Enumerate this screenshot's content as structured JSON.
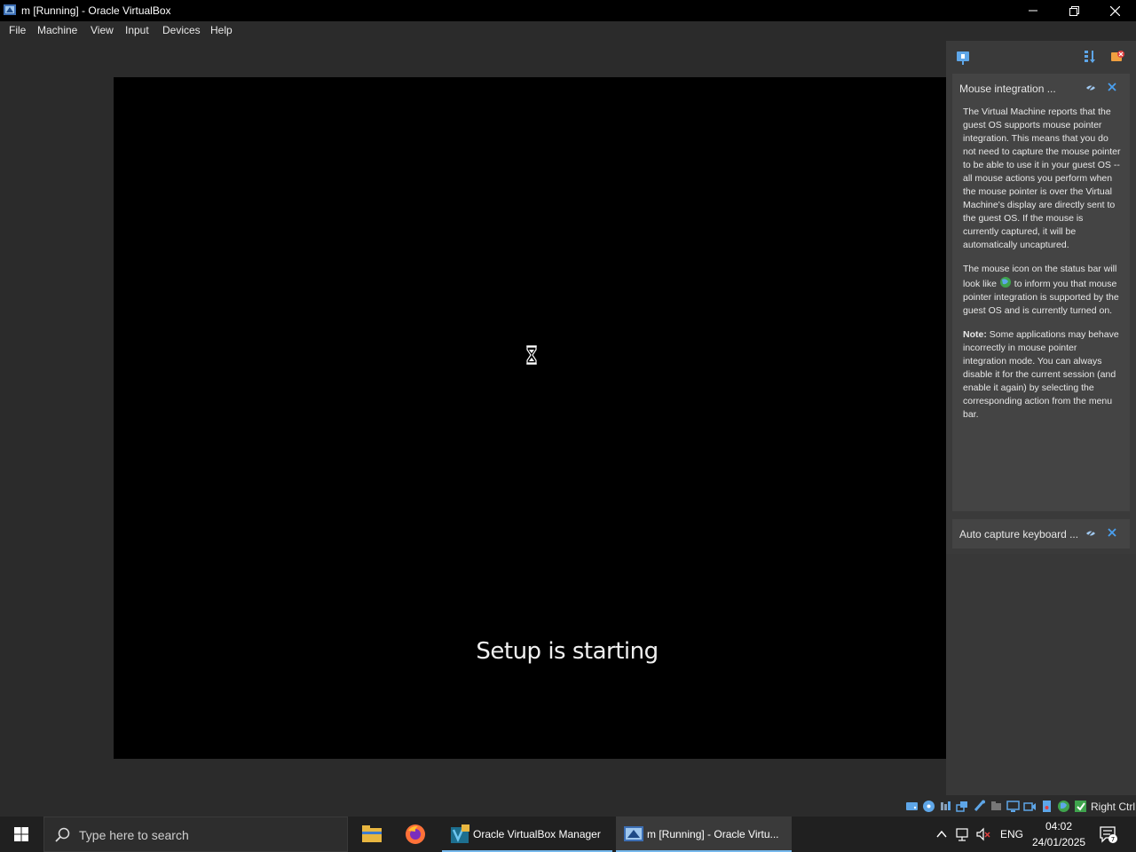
{
  "window": {
    "title": "m [Running] - Oracle VirtualBox",
    "minimize_icon": "minimize-icon",
    "maximize_icon": "restore-icon",
    "close_icon": "close-icon"
  },
  "menu": {
    "items": [
      {
        "label": "File"
      },
      {
        "label": "Machine"
      },
      {
        "label": "View"
      },
      {
        "label": "Input"
      },
      {
        "label": "Devices"
      },
      {
        "label": "Help"
      }
    ]
  },
  "vm_screen": {
    "status_text": "Setup is starting",
    "cursor": "hourglass-icon"
  },
  "side_panel": {
    "notifications": [
      {
        "title": "Mouse integration ...",
        "paragraphs": [
          "The Virtual Machine reports that the guest OS supports mouse pointer integration. This means that you do not need to capture the mouse pointer to be able to use it in your guest OS -- all mouse actions you perform when the mouse pointer is over the Virtual Machine's display are directly sent to the guest OS. If the mouse is currently captured, it will be automatically uncaptured.",
          "The mouse icon on the status bar will look like",
          "to inform you that mouse pointer integration is supported by the guest OS and is currently turned on.",
          "Note:",
          "Some applications may behave incorrectly in mouse pointer integration mode. You can always disable it for the current session (and enable it again) by selecting the corresponding action from the menu bar."
        ],
        "bold_phrase": "mouse pointer integration.",
        "italic_word": "capture"
      },
      {
        "title": "Auto capture keyboard ..."
      }
    ]
  },
  "statusbar": {
    "host_key": "Right Ctrl"
  },
  "taskbar": {
    "search_placeholder": "Type here to search",
    "apps": [
      {
        "label": "Oracle VirtualBox Manager"
      },
      {
        "label": "m [Running] - Oracle Virtu..."
      }
    ],
    "language": "ENG",
    "time": "04:02",
    "date": "24/01/2025",
    "notification_count": "7"
  },
  "colors": {
    "accent": "#76b9ed",
    "taskbar": "#202020",
    "panel": "#3a3a3a"
  }
}
